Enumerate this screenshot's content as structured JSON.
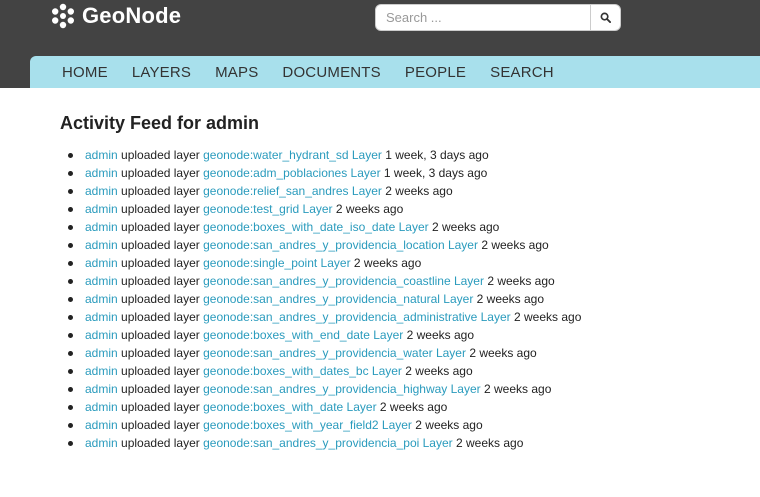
{
  "brand": {
    "name": "GeoNode"
  },
  "search": {
    "placeholder": "Search ...",
    "icon": "search-icon"
  },
  "nav": {
    "items": [
      "HOME",
      "LAYERS",
      "MAPS",
      "DOCUMENTS",
      "PEOPLE",
      "SEARCH"
    ]
  },
  "colors": {
    "topbar": "#434343",
    "navbar": "#a8e0ec",
    "link": "#2a9bbd"
  },
  "page": {
    "title": "Activity Feed for admin"
  },
  "feed": [
    {
      "actor": "admin",
      "verb": "uploaded layer",
      "target": "geonode:water_hydrant_sd Layer",
      "time": "1 week, 3 days ago"
    },
    {
      "actor": "admin",
      "verb": "uploaded layer",
      "target": "geonode:adm_poblaciones Layer",
      "time": "1 week, 3 days ago"
    },
    {
      "actor": "admin",
      "verb": "uploaded layer",
      "target": "geonode:relief_san_andres Layer",
      "time": "2 weeks ago"
    },
    {
      "actor": "admin",
      "verb": "uploaded layer",
      "target": "geonode:test_grid Layer",
      "time": "2 weeks ago"
    },
    {
      "actor": "admin",
      "verb": "uploaded layer",
      "target": "geonode:boxes_with_date_iso_date Layer",
      "time": "2 weeks ago"
    },
    {
      "actor": "admin",
      "verb": "uploaded layer",
      "target": "geonode:san_andres_y_providencia_location Layer",
      "time": "2 weeks ago"
    },
    {
      "actor": "admin",
      "verb": "uploaded layer",
      "target": "geonode:single_point Layer",
      "time": "2 weeks ago"
    },
    {
      "actor": "admin",
      "verb": "uploaded layer",
      "target": "geonode:san_andres_y_providencia_coastline Layer",
      "time": "2 weeks ago"
    },
    {
      "actor": "admin",
      "verb": "uploaded layer",
      "target": "geonode:san_andres_y_providencia_natural Layer",
      "time": "2 weeks ago"
    },
    {
      "actor": "admin",
      "verb": "uploaded layer",
      "target": "geonode:san_andres_y_providencia_administrative Layer",
      "time": "2 weeks ago"
    },
    {
      "actor": "admin",
      "verb": "uploaded layer",
      "target": "geonode:boxes_with_end_date Layer",
      "time": "2 weeks ago"
    },
    {
      "actor": "admin",
      "verb": "uploaded layer",
      "target": "geonode:san_andres_y_providencia_water Layer",
      "time": "2 weeks ago"
    },
    {
      "actor": "admin",
      "verb": "uploaded layer",
      "target": "geonode:boxes_with_dates_bc Layer",
      "time": "2 weeks ago"
    },
    {
      "actor": "admin",
      "verb": "uploaded layer",
      "target": "geonode:san_andres_y_providencia_highway Layer",
      "time": "2 weeks ago"
    },
    {
      "actor": "admin",
      "verb": "uploaded layer",
      "target": "geonode:boxes_with_date Layer",
      "time": "2 weeks ago"
    },
    {
      "actor": "admin",
      "verb": "uploaded layer",
      "target": "geonode:boxes_with_year_field2 Layer",
      "time": "2 weeks ago"
    },
    {
      "actor": "admin",
      "verb": "uploaded layer",
      "target": "geonode:san_andres_y_providencia_poi Layer",
      "time": "2 weeks ago"
    }
  ]
}
